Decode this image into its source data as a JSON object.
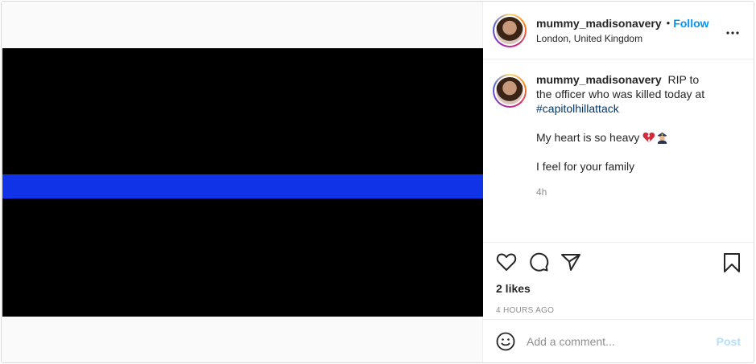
{
  "post": {
    "username": "mummy_madisonavery",
    "separator": "•",
    "follow_label": "Follow",
    "location": "London, United Kingdom",
    "more_icon": "more-horizontal-icon",
    "caption": {
      "text_before": "RIP to the officer who was killed today at",
      "hashtag": "#capitolhillattack",
      "line2": "My heart is so heavy",
      "line2_emojis": [
        "broken-heart",
        "police-officer"
      ],
      "line3": "I feel for your family"
    },
    "timestamp": "4h",
    "likes": "2 likes",
    "time_ago": "4 HOURS AGO",
    "comment_placeholder": "Add a comment...",
    "post_label": "Post"
  },
  "colors": {
    "link_blue": "#0095f6",
    "hashtag_blue": "#00376b",
    "flag_stripe": "#1133e8",
    "muted": "#8e8e8e"
  }
}
